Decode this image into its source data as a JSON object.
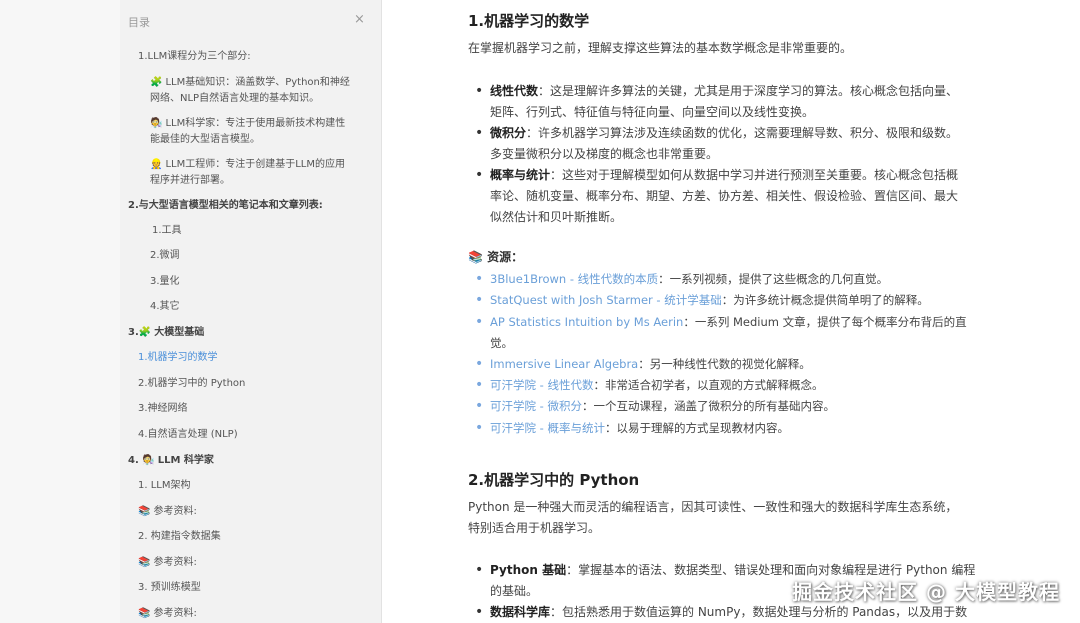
{
  "toc": {
    "header": "目录",
    "close_glyph": "×",
    "items": [
      {
        "text": "1.LLM课程分为三个部分:"
      },
      {
        "emoji": "🧩",
        "line1": "LLM基础知识：涵盖数学、Python和神经",
        "line2": "网络、NLP自然语言处理的基本知识。"
      },
      {
        "emoji": "🧑‍🔬",
        "line1": "LLM科学家：专注于使用最新技术构建性",
        "line2": "能最佳的大型语言模型。"
      },
      {
        "emoji": "👷",
        "line1": "LLM工程师：专注于创建基于LLM的应用",
        "line2": "程序并进行部署。"
      },
      {
        "text": "2.与大型语言模型相关的笔记本和文章列表:"
      },
      {
        "text": "1.工具"
      },
      {
        "text": "2.微调"
      },
      {
        "text": "3.量化"
      },
      {
        "text": "4.其它"
      },
      {
        "prefix": "3.",
        "emoji": "🧩",
        "text": "大模型基础"
      },
      {
        "text": "1.机器学习的数学"
      },
      {
        "text": "2.机器学习中的 Python"
      },
      {
        "text": "3.神经网络"
      },
      {
        "text": "4.自然语言处理 (NLP)"
      },
      {
        "prefix": "4. ",
        "emoji": "🧑‍🔬",
        "text": "LLM 科学家"
      },
      {
        "text": "1. LLM架构"
      },
      {
        "emoji": "📚",
        "text": "参考资料:"
      },
      {
        "text": "2. 构建指令数据集"
      },
      {
        "emoji": "📚",
        "text": "参考资料:"
      },
      {
        "text": "3. 预训练模型"
      },
      {
        "emoji": "📚",
        "text": "参考资料:"
      }
    ]
  },
  "content": {
    "section1": {
      "title": "1.机器学习的数学",
      "intro": "在掌握机器学习之前，理解支撑这些算法的基本数学概念是非常重要的。",
      "bullets": [
        {
          "term": "线性代数",
          "line1": "：这是理解许多算法的关键，尤其是用于深度学习的算法。核心概念包括向量、",
          "line2": "矩阵、行列式、特征值与特征向量、向量空间以及线性变换。"
        },
        {
          "term": "微积分",
          "line1": "：许多机器学习算法涉及连续函数的优化，这需要理解导数、积分、极限和级数。",
          "line2": "多变量微积分以及梯度的概念也非常重要。"
        },
        {
          "term": "概率与统计",
          "line1": "：这些对于理解模型如何从数据中学习并进行预测至关重要。核心概念包括概",
          "line2": "率论、随机变量、概率分布、期望、方差、协方差、相关性、假设检验、置信区间、最大",
          "line3": "似然估计和贝叶斯推断。"
        }
      ],
      "resources_emoji": "📚",
      "resources_label": "资源：",
      "resources": [
        {
          "link": "3Blue1Brown - 线性代数的本质",
          "desc": "：一系列视频，提供了这些概念的几何直觉。"
        },
        {
          "link": "StatQuest with Josh Starmer - 统计学基础",
          "desc": "：为许多统计概念提供简单明了的解释。"
        },
        {
          "link": "AP Statistics Intuition by Ms Aerin",
          "desc": "：一系列 Medium 文章，提供了每个概率分布背后的直",
          "desc2": "觉。"
        },
        {
          "link": "Immersive Linear Algebra",
          "desc": "：另一种线性代数的视觉化解释。"
        },
        {
          "link": "可汗学院 - 线性代数",
          "desc": "：非常适合初学者，以直观的方式解释概念。"
        },
        {
          "link": "可汗学院 - 微积分",
          "desc": "：一个互动课程，涵盖了微积分的所有基础内容。"
        },
        {
          "link": "可汗学院 - 概率与统计",
          "desc": "：以易于理解的方式呈现教材内容。"
        }
      ]
    },
    "section2": {
      "title": "2.机器学习中的 Python",
      "intro1": "Python 是一种强大而灵活的编程语言，因其可读性、一致性和强大的数据科学库生态系统，",
      "intro2": "特别适合用于机器学习。",
      "bullets": [
        {
          "term": "Python 基础",
          "line1": "：掌握基本的语法、数据类型、错误处理和面向对象编程是进行 Python 编程",
          "line2": "的基础。"
        },
        {
          "term": "数据科学库",
          "line1": "：包括熟悉用于数值运算的 NumPy，数据处理与分析的 Pandas，以及用于数"
        }
      ]
    }
  },
  "watermark": "掘金技术社区 @ 大模型教程"
}
